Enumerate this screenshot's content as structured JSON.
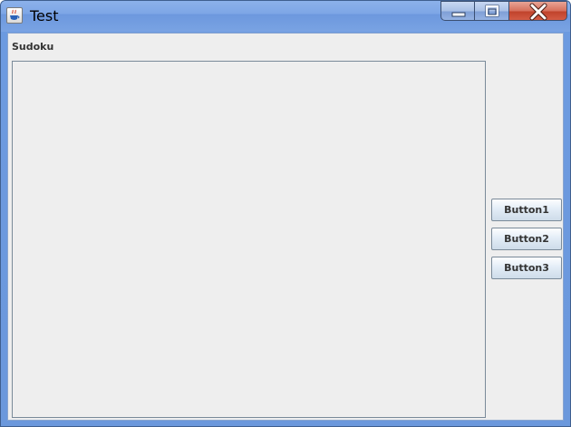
{
  "window": {
    "title": "Test",
    "icon": "java-cup-icon",
    "caption_buttons": [
      "minimize-icon",
      "maximize-icon",
      "close-icon"
    ]
  },
  "content": {
    "panel_title": "Sudoku",
    "buttons": [
      {
        "label": "Button1"
      },
      {
        "label": "Button2"
      },
      {
        "label": "Button3"
      }
    ]
  }
}
